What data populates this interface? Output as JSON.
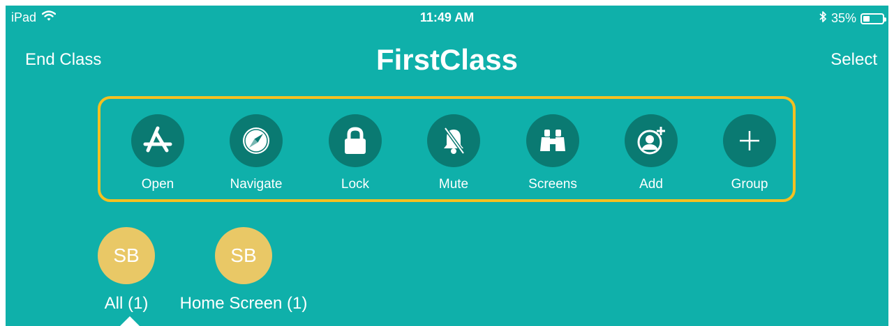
{
  "status_bar": {
    "device": "iPad",
    "time": "11:49 AM",
    "battery_text": "35%",
    "battery_level": 0.35
  },
  "nav": {
    "left_button": "End Class",
    "title": "FirstClass",
    "right_button": "Select"
  },
  "toolbar": {
    "items": [
      {
        "label": "Open",
        "icon": "app-store-icon"
      },
      {
        "label": "Navigate",
        "icon": "compass-icon"
      },
      {
        "label": "Lock",
        "icon": "lock-icon"
      },
      {
        "label": "Mute",
        "icon": "muted-bell-icon"
      },
      {
        "label": "Screens",
        "icon": "binoculars-icon"
      },
      {
        "label": "Add",
        "icon": "add-person-icon"
      },
      {
        "label": "Group",
        "icon": "plus-icon"
      }
    ]
  },
  "groups": [
    {
      "initials": "SB",
      "label": "All (1)"
    },
    {
      "initials": "SB",
      "label": "Home Screen (1)"
    }
  ],
  "colors": {
    "background": "#0fb0aa",
    "icon_circle": "#0a7a72",
    "highlight_border": "#f5c020",
    "avatar": "#e9c866"
  }
}
